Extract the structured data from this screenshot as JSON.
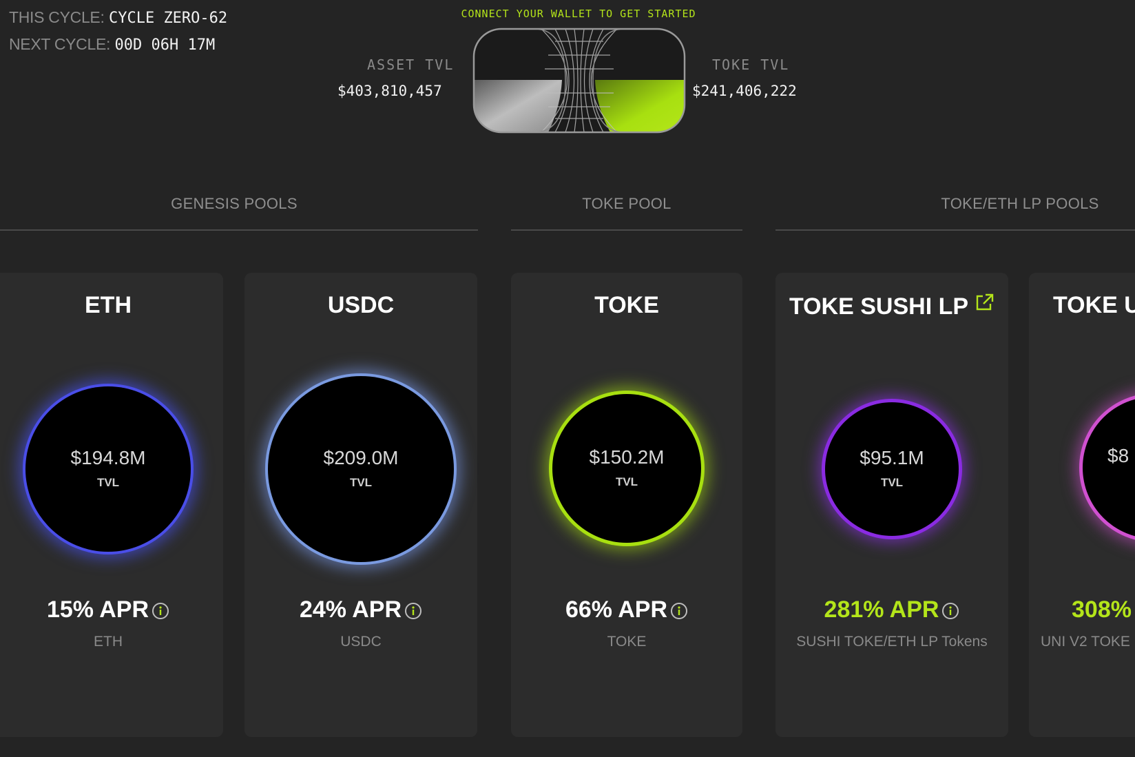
{
  "cycle": {
    "this_label": "THIS CYCLE:",
    "this_value": "CYCLE ZERO-62",
    "next_label": "NEXT CYCLE:",
    "next_value": "00D 06H 17M"
  },
  "header": {
    "connect_text": "CONNECT YOUR WALLET TO GET STARTED",
    "asset_tvl_label": "ASSET TVL",
    "asset_tvl_value": "$403,810,457",
    "toke_tvl_label": "TOKE TVL",
    "toke_tvl_value": "$241,406,222"
  },
  "colors": {
    "accent_green": "#b4e51a",
    "eth_ring": "#4a4ee8",
    "usdc_ring": "#7a9ae0",
    "toke_ring": "#a8e010",
    "sushi_ring": "#8a2be2",
    "uni_ring": "#d050d0"
  },
  "sections": [
    {
      "label": "GENESIS POOLS"
    },
    {
      "label": "TOKE POOL"
    },
    {
      "label": "TOKE/ETH LP POOLS"
    }
  ],
  "pools": [
    {
      "title": "ETH",
      "tvl": "$194.8M",
      "tvl_label": "TVL",
      "apr": "15% APR",
      "asset": "ETH",
      "icon": "info-icon"
    },
    {
      "title": "USDC",
      "tvl": "$209.0M",
      "tvl_label": "TVL",
      "apr": "24% APR",
      "asset": "USDC",
      "icon": "info-icon"
    },
    {
      "title": "TOKE",
      "tvl": "$150.2M",
      "tvl_label": "TVL",
      "apr": "66% APR",
      "asset": "TOKE",
      "icon": "info-icon"
    },
    {
      "title": "TOKE SUSHI LP",
      "tvl": "$95.1M",
      "tvl_label": "TVL",
      "apr": "281% APR",
      "asset": "SUSHI TOKE/ETH LP Tokens",
      "icon": "external-link-icon"
    },
    {
      "title": "TOKE U",
      "tvl": "$8",
      "tvl_label": "T",
      "apr": "308%",
      "asset": "UNI V2 TOKE"
    }
  ]
}
